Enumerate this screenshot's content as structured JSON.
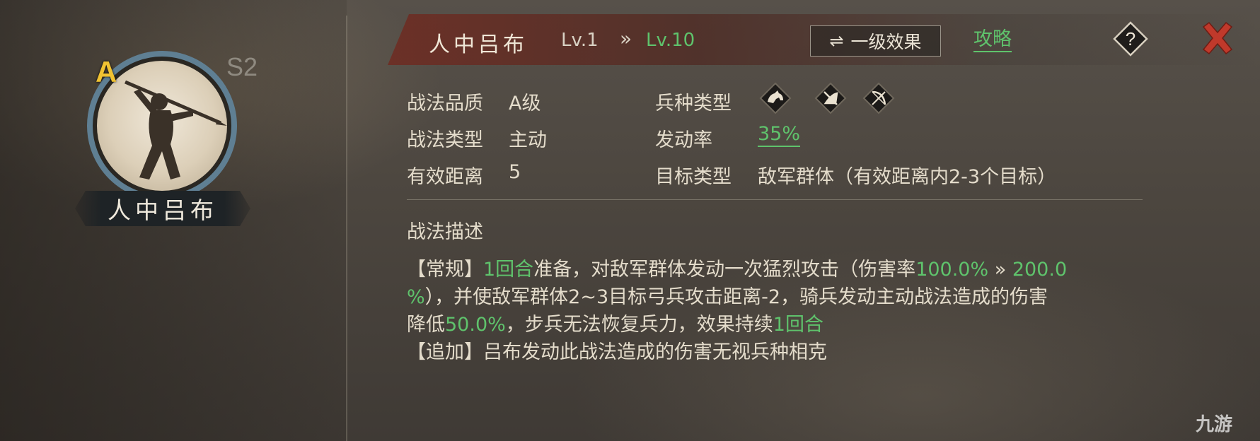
{
  "skill": {
    "name": "人中吕布",
    "grade": "A",
    "season": "S2",
    "level_from": "Lv.1",
    "level_arrow": "»",
    "level_to": "Lv.10"
  },
  "header": {
    "effect_button_icon": "⇌",
    "effect_button_label": "一级效果",
    "strategy_link": "攻略",
    "help_icon": "question-icon",
    "close_icon": "close-icon"
  },
  "info": {
    "quality_label": "战法品质",
    "quality_value": "A级",
    "type_label": "战法类型",
    "type_value": "主动",
    "range_label": "有效距离",
    "range_value": "5",
    "unit_label": "兵种类型",
    "unit_icons": [
      "cavalry-icon",
      "infantry-icon",
      "archer-icon"
    ],
    "rate_label": "发动率",
    "rate_value": "35%",
    "target_label": "目标类型",
    "target_value": "敌军群体（有效距离内2-3个目标）"
  },
  "description": {
    "title": "战法描述",
    "line1_a": "【常规】",
    "line1_b": "1回合",
    "line1_c": "准备，对敌军群体发动一次猛烈攻击（伤害率",
    "line1_d": "100.0%",
    "line1_e": " » ",
    "line1_f": "200.0",
    "line2_a": "%",
    "line2_b": "），并使敌军群体2~3目标弓兵攻击距离-2，骑兵发动主动战法造成的伤害",
    "line3_a": "降低",
    "line3_b": "50.0%",
    "line3_c": "，步兵无法恢复兵力，效果持续",
    "line3_d": "1回合",
    "line4": "【追加】吕布发动此战法造成的伤害无视兵种相克"
  },
  "watermark": "九游",
  "colors": {
    "accent_green": "#5fc36c",
    "grade_gold": "#f1c232",
    "close_red": "#c0392b",
    "header_red": "#6e2d23"
  }
}
